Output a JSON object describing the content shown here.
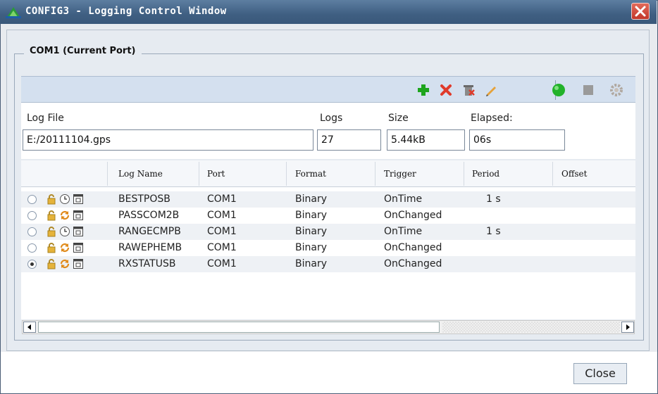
{
  "window": {
    "title": "CONFIG3 - Logging Control Window"
  },
  "group": {
    "title": "COM1 (Current Port)"
  },
  "toolbar": {
    "icons": [
      "add-icon",
      "delete-icon",
      "delete-all-icon",
      "edit-icon",
      "start-icon",
      "stop-icon",
      "settings-icon"
    ],
    "colors": {
      "add": "#1ea51e",
      "delete": "#e03a2a",
      "start": "#22b22a",
      "stop": "#9a9a9a"
    }
  },
  "fields": {
    "log_file": {
      "label": "Log File",
      "value": "E:/20111104.gps"
    },
    "logs": {
      "label": "Logs",
      "value": "27"
    },
    "size": {
      "label": "Size",
      "value": "5.44kB"
    },
    "elapsed": {
      "label": "Elapsed:",
      "value": "06s"
    }
  },
  "table": {
    "columns": [
      "Log Name",
      "Port",
      "Format",
      "Trigger",
      "Period",
      "Offset"
    ],
    "rows": [
      {
        "name": "BESTPOSB",
        "port": "COM1",
        "format": "Binary",
        "trigger": "OnTime",
        "period": "1 s",
        "offset": "",
        "selected": false,
        "trigger_icon": "clock-icon"
      },
      {
        "name": "PASSCOM2B",
        "port": "COM1",
        "format": "Binary",
        "trigger": "OnChanged",
        "period": "",
        "offset": "",
        "selected": false,
        "trigger_icon": "refresh-icon"
      },
      {
        "name": "RANGECMPB",
        "port": "COM1",
        "format": "Binary",
        "trigger": "OnTime",
        "period": "1 s",
        "offset": "",
        "selected": false,
        "trigger_icon": "clock-icon"
      },
      {
        "name": "RAWEPHEMB",
        "port": "COM1",
        "format": "Binary",
        "trigger": "OnChanged",
        "period": "",
        "offset": "",
        "selected": false,
        "trigger_icon": "refresh-icon"
      },
      {
        "name": "RXSTATUSB",
        "port": "COM1",
        "format": "Binary",
        "trigger": "OnChanged",
        "period": "",
        "offset": "",
        "selected": true,
        "trigger_icon": "refresh-icon"
      }
    ]
  },
  "buttons": {
    "close": "Close"
  }
}
